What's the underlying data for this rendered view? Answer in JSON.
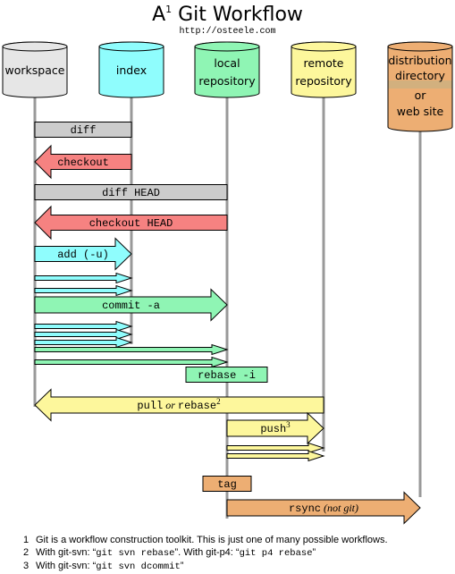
{
  "header": {
    "title": "A",
    "title_sup": "1",
    "title_rest": " Git Workflow",
    "url": "http://osteele.com"
  },
  "stores": [
    {
      "id": "workspace",
      "lines": [
        "workspace"
      ],
      "color": "#e6e6e6"
    },
    {
      "id": "index",
      "lines": [
        "index"
      ],
      "color": "#8ffdfd"
    },
    {
      "id": "local-repository",
      "lines": [
        "local",
        "repository"
      ],
      "color": "#8ff5b4"
    },
    {
      "id": "remote-repository",
      "lines": [
        "remote",
        "repository"
      ],
      "color": "#fdf79c"
    },
    {
      "id": "distribution-directory",
      "lines": [
        "distribution",
        "directory",
        "or",
        "web site"
      ],
      "color": "#edae73"
    }
  ],
  "colors": {
    "gray": "#cccccc",
    "red": "#f68281",
    "cyan": "#8ffdfd",
    "green": "#8ff5b4",
    "yellow": "#fdf79c",
    "orange": "#edae73",
    "lifeline": "#999999"
  },
  "operations": [
    {
      "label": "diff",
      "from": "workspace",
      "to": "index",
      "kind": "bar",
      "color": "gray"
    },
    {
      "label": "checkout",
      "from": "index",
      "to": "workspace",
      "kind": "arrow",
      "color": "red"
    },
    {
      "label": "diff HEAD",
      "from": "workspace",
      "to": "local-repository",
      "kind": "bar",
      "color": "gray"
    },
    {
      "label": "checkout HEAD",
      "from": "local-repository",
      "to": "workspace",
      "kind": "arrow",
      "color": "red"
    },
    {
      "label": "add (-u)",
      "from": "workspace",
      "to": "index",
      "kind": "arrow",
      "color": "cyan"
    },
    {
      "label": "commit -a",
      "from": "workspace",
      "to": "local-repository",
      "kind": "arrow",
      "color": "green"
    },
    {
      "label": "rebase -i",
      "from": "local-repository",
      "to": "local-repository",
      "kind": "box",
      "color": "green"
    },
    {
      "label": "pull",
      "label_or": "or",
      "label_rest": "rebase",
      "label_sup": "2",
      "from": "remote-repository",
      "to": "workspace",
      "kind": "arrow",
      "color": "yellow"
    },
    {
      "label": "push",
      "label_sup": "3",
      "from": "local-repository",
      "to": "remote-repository",
      "kind": "arrow",
      "color": "yellow"
    },
    {
      "label": "tag",
      "from": "local-repository",
      "to": "local-repository",
      "kind": "box",
      "color": "orange"
    },
    {
      "label": "rsync",
      "label_note": "(not git)",
      "from": "local-repository",
      "to": "distribution-directory",
      "kind": "arrow",
      "color": "orange"
    }
  ],
  "footnotes": [
    {
      "num": "1",
      "parts": [
        {
          "text": "Git is a workflow construction toolkit.  This is just one of many possible workflows.",
          "code": false
        }
      ]
    },
    {
      "num": "2",
      "parts": [
        {
          "text": "With git-svn: “",
          "code": false
        },
        {
          "text": "git svn rebase",
          "code": true
        },
        {
          "text": "”.  With git-p4: “",
          "code": false
        },
        {
          "text": "git p4 rebase",
          "code": true
        },
        {
          "text": "”",
          "code": false
        }
      ]
    },
    {
      "num": "3",
      "parts": [
        {
          "text": "With git-svn: “",
          "code": false
        },
        {
          "text": "git svn dcommit",
          "code": true
        },
        {
          "text": "”",
          "code": false
        }
      ]
    }
  ]
}
